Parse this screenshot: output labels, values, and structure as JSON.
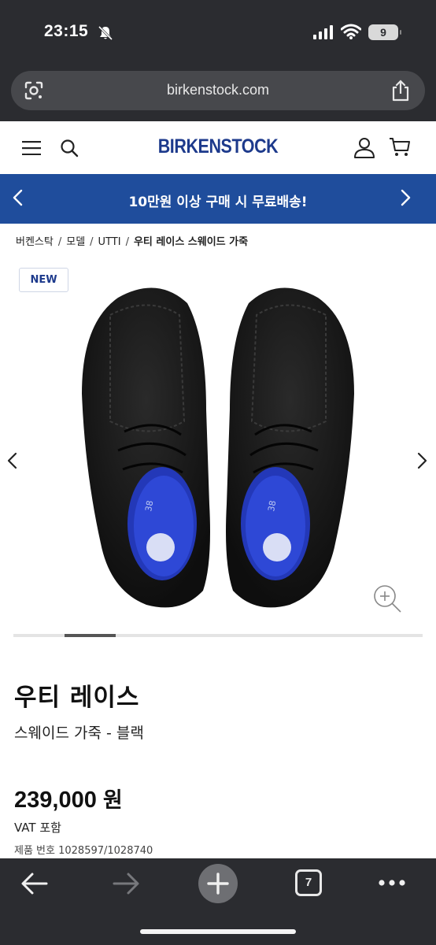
{
  "status": {
    "time": "23:15",
    "battery": "9"
  },
  "browser": {
    "url": "birkenstock.com"
  },
  "site": {
    "logo": "BIRKENSTOCK"
  },
  "promo": {
    "text": "10만원 이상 구매 시 무료배송!"
  },
  "breadcrumb": [
    "버켄스탁",
    "모델",
    "UTTI",
    "우티 레이스 스웨이드 가죽"
  ],
  "badge": "NEW",
  "gallery": {
    "slide_index": 2,
    "slide_count": 8
  },
  "product": {
    "name": "우티 레이스",
    "subtitle": "스웨이드 가죽 - 블랙",
    "price": "239,000",
    "currency": "원",
    "vat": "VAT 포함",
    "product_number": "제품 번호 1028597/1028740"
  },
  "toolbar": {
    "tab_count": "7"
  },
  "colors": {
    "brand": "#1d3a8c",
    "promo_bg": "#1f4d9c",
    "chrome": "#2b2c30"
  },
  "icons": [
    "bell-slash-icon",
    "signal-icon",
    "wifi-icon",
    "lens-icon",
    "share-icon",
    "menu-icon",
    "search-icon",
    "user-icon",
    "cart-icon",
    "chevron-left-icon",
    "chevron-right-icon",
    "zoom-icon",
    "back-arrow-icon",
    "forward-arrow-icon",
    "plus-icon",
    "more-icon"
  ]
}
